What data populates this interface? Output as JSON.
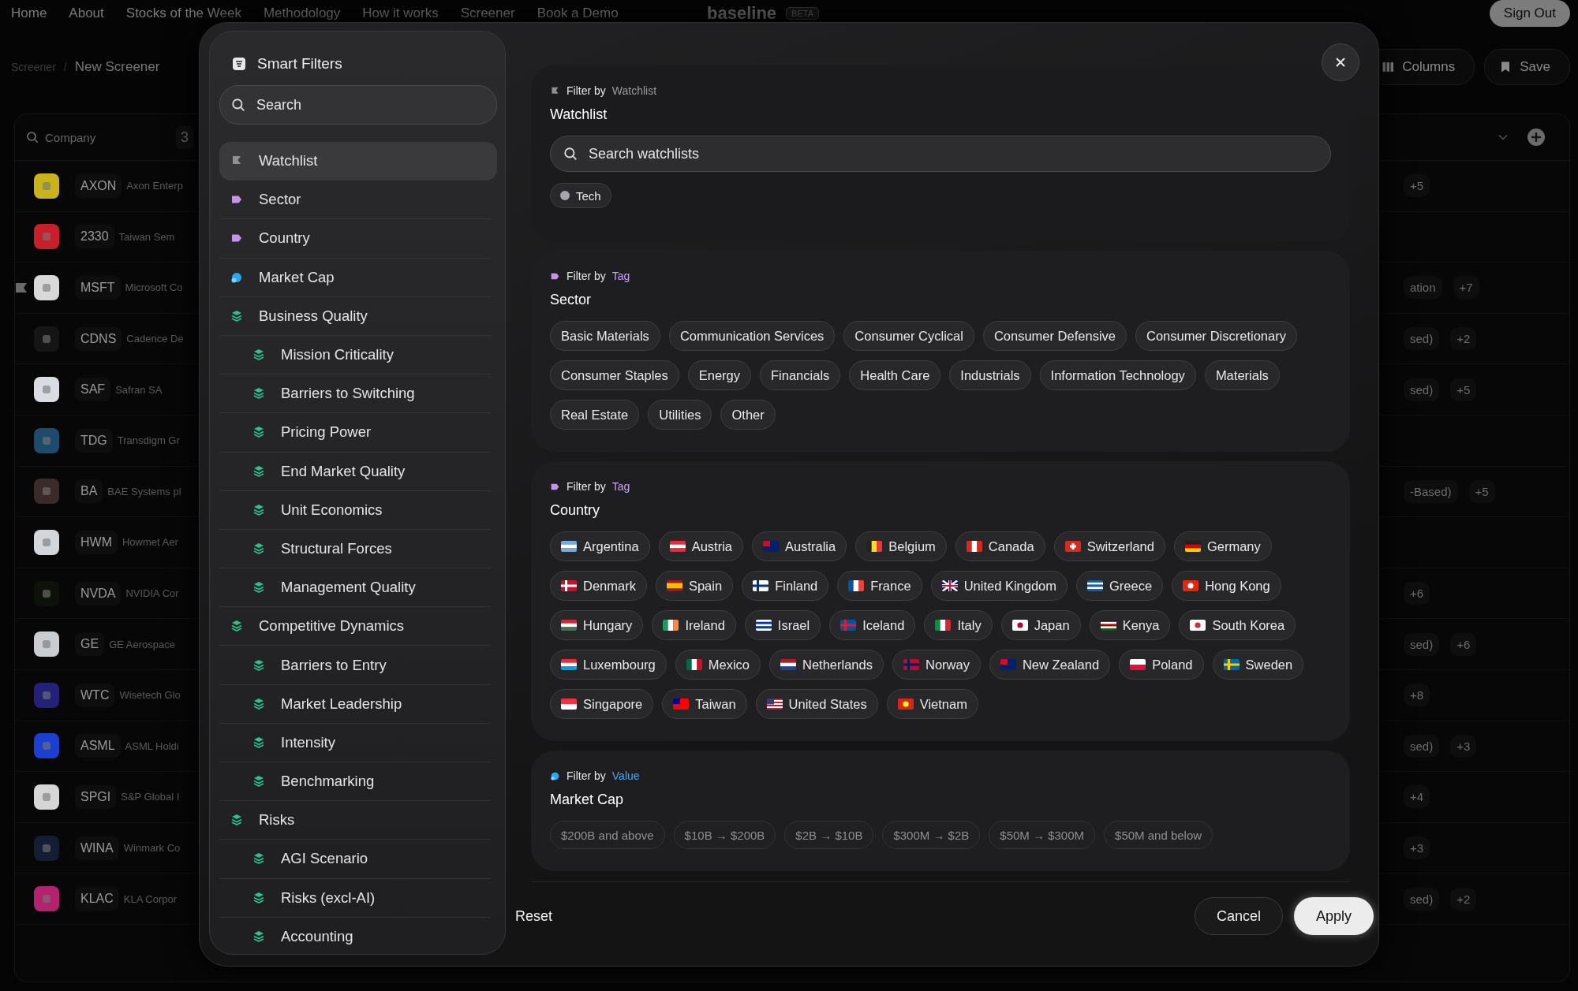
{
  "nav": {
    "links": [
      "Home",
      "About",
      "Stocks of the Week",
      "Methodology",
      "How it works",
      "Screener",
      "Book a Demo"
    ],
    "logo": "baseline",
    "badge": "BETA",
    "sign_out": "Sign Out"
  },
  "breadcrumb": {
    "parent": "Screener",
    "separator": "/",
    "current": "New Screener"
  },
  "toolbar": {
    "columns": "Columns",
    "save": "Save"
  },
  "table": {
    "search_placeholder": "Company",
    "count": "3",
    "rows": [
      {
        "ticker": "AXON",
        "name": "Axon Enterp",
        "color": "#c9b21c",
        "watchlisted": false,
        "more": "+5"
      },
      {
        "ticker": "2330",
        "name": "Taiwan Sem",
        "color": "#c8202a",
        "watchlisted": false
      },
      {
        "ticker": "MSFT",
        "name": "Microsoft Co",
        "color": "#d9d9d9",
        "watchlisted": true,
        "tag": "ation",
        "more": "+7"
      },
      {
        "ticker": "CDNS",
        "name": "Cadence De",
        "color": "#151515",
        "watchlisted": false,
        "tag": "sed)",
        "more": "+2"
      },
      {
        "ticker": "SAF",
        "name": "Safran SA",
        "color": "#d9dce3",
        "watchlisted": false,
        "tag": "sed)",
        "more": "+5"
      },
      {
        "ticker": "TDG",
        "name": "Transdigm Gr",
        "color": "#1e4a6b",
        "watchlisted": false
      },
      {
        "ticker": "BA",
        "name": "BAE Systems pl",
        "color": "#3a2a2a",
        "watchlisted": false,
        "tag": "-Based)",
        "more": "+5"
      },
      {
        "ticker": "HWM",
        "name": "Howmet Aer",
        "color": "#d3d7dc",
        "watchlisted": false
      },
      {
        "ticker": "NVDA",
        "name": "NVIDIA Cor",
        "color": "#0c120a",
        "watchlisted": false,
        "more": "+6"
      },
      {
        "ticker": "GE",
        "name": "GE Aerospace",
        "color": "#c9ccd1",
        "watchlisted": false,
        "tag": "sed)",
        "more": "+6"
      },
      {
        "ticker": "WTC",
        "name": "Wisetech Glo",
        "color": "#23217a",
        "watchlisted": false,
        "more": "+8"
      },
      {
        "ticker": "ASML",
        "name": "ASML Holdi",
        "color": "#1b3fd0",
        "watchlisted": false,
        "tag": "sed)",
        "more": "+3"
      },
      {
        "ticker": "SPGI",
        "name": "S&P Global I",
        "color": "#d6d6d6",
        "watchlisted": false,
        "more": "+4"
      },
      {
        "ticker": "WINA",
        "name": "Winmark Co",
        "color": "#141d33",
        "watchlisted": false,
        "more": "+3"
      },
      {
        "ticker": "KLAC",
        "name": "KLA Corpor",
        "color": "#b3226e",
        "watchlisted": false,
        "tag": "sed)",
        "more": "+2"
      }
    ]
  },
  "modal": {
    "title": "Smart Filters",
    "search_placeholder": "Search",
    "sidebar": [
      {
        "label": "Watchlist",
        "kind": "watchlist",
        "selected": true
      },
      {
        "label": "Sector",
        "kind": "tag",
        "selected": false
      },
      {
        "label": "Country",
        "kind": "tag",
        "selected": false
      },
      {
        "label": "Market Cap",
        "kind": "value",
        "selected": false
      },
      {
        "label": "Business Quality",
        "kind": "group",
        "selected": false,
        "children": [
          {
            "label": "Mission Criticality",
            "kind": "group",
            "selected": false
          },
          {
            "label": "Barriers to Switching",
            "kind": "group",
            "selected": false
          },
          {
            "label": "Pricing Power",
            "kind": "group",
            "selected": false
          },
          {
            "label": "End Market Quality",
            "kind": "group",
            "selected": false
          },
          {
            "label": "Unit Economics",
            "kind": "group",
            "selected": false
          },
          {
            "label": "Structural Forces",
            "kind": "group",
            "selected": false
          },
          {
            "label": "Management Quality",
            "kind": "group",
            "selected": false
          }
        ]
      },
      {
        "label": "Competitive Dynamics",
        "kind": "group",
        "selected": false,
        "children": [
          {
            "label": "Barriers to Entry",
            "kind": "group",
            "selected": false
          },
          {
            "label": "Market Leadership",
            "kind": "group",
            "selected": false
          },
          {
            "label": "Intensity",
            "kind": "group",
            "selected": false
          },
          {
            "label": "Benchmarking",
            "kind": "group",
            "selected": false
          }
        ]
      },
      {
        "label": "Risks",
        "kind": "group",
        "selected": false,
        "children": [
          {
            "label": "AGI Scenario",
            "kind": "group",
            "selected": false
          },
          {
            "label": "Risks (excl-AI)",
            "kind": "group",
            "selected": false
          },
          {
            "label": "Accounting",
            "kind": "group",
            "selected": false
          }
        ]
      }
    ],
    "sections": [
      {
        "kind": "watchlist",
        "filter_by": "Filter by",
        "source": "Watchlist",
        "title": "Watchlist",
        "search_placeholder": "Search watchlists",
        "chips": [
          "Tech"
        ]
      },
      {
        "kind": "sector",
        "filter_by": "Filter by",
        "source": "Tag",
        "title": "Sector",
        "chips": [
          "Basic Materials",
          "Communication Services",
          "Consumer Cyclical",
          "Consumer Defensive",
          "Consumer Discretionary",
          "Consumer Staples",
          "Energy",
          "Financials",
          "Health Care",
          "Industrials",
          "Information Technology",
          "Materials",
          "Real Estate",
          "Utilities",
          "Other"
        ]
      },
      {
        "kind": "country",
        "filter_by": "Filter by",
        "source": "Tag",
        "title": "Country",
        "chips": [
          "Argentina",
          "Austria",
          "Australia",
          "Belgium",
          "Canada",
          "Switzerland",
          "Germany",
          "Denmark",
          "Spain",
          "Finland",
          "France",
          "United Kingdom",
          "Greece",
          "Hong Kong",
          "Hungary",
          "Ireland",
          "Israel",
          "Iceland",
          "Italy",
          "Japan",
          "Kenya",
          "South Korea",
          "Luxembourg",
          "Mexico",
          "Netherlands",
          "Norway",
          "New Zealand",
          "Poland",
          "Sweden",
          "Singapore",
          "Taiwan",
          "United States",
          "Vietnam"
        ]
      },
      {
        "kind": "value",
        "filter_by": "Filter by",
        "source": "Value",
        "title": "Market Cap",
        "chips": [
          "$200B and above",
          "$10B → $200B",
          "$2B → $10B",
          "$300M → $2B",
          "$50M → $300M",
          "$50M and below"
        ]
      }
    ],
    "footer": {
      "reset": "Reset",
      "cancel": "Cancel",
      "apply": "Apply"
    }
  }
}
